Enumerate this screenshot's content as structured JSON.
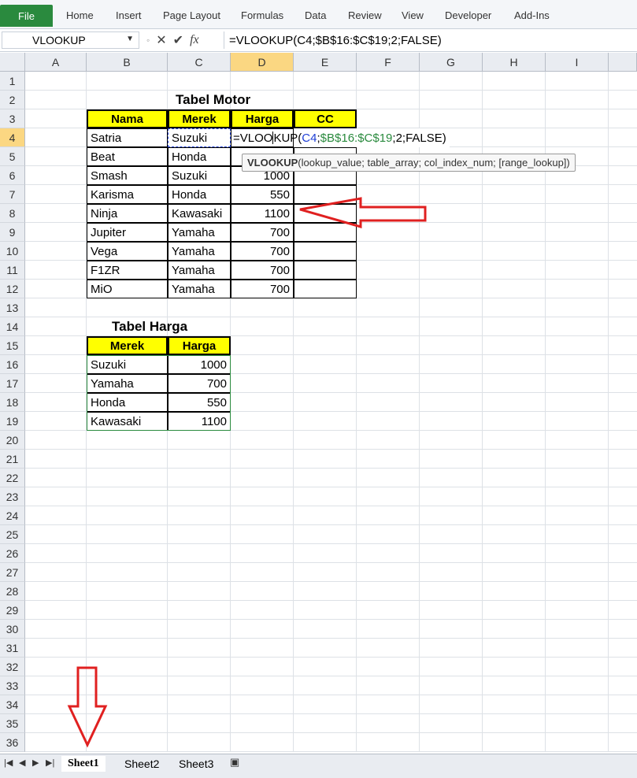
{
  "ribbon": {
    "file": "File",
    "tabs": [
      "Home",
      "Insert",
      "Page Layout",
      "Formulas",
      "Data",
      "Review",
      "View",
      "Developer",
      "Add-Ins"
    ]
  },
  "formula_bar": {
    "name_box": "VLOOKUP",
    "fx": "fx",
    "formula": "=VLOOKUP(C4;$B$16:$C$19;2;FALSE)"
  },
  "columns": [
    "A",
    "B",
    "C",
    "D",
    "E",
    "F",
    "G",
    "H",
    "I"
  ],
  "rows": [
    "1",
    "2",
    "3",
    "4",
    "5",
    "6",
    "7",
    "8",
    "9",
    "10",
    "11",
    "12",
    "13",
    "14",
    "15",
    "16",
    "17",
    "18",
    "19",
    "20",
    "21",
    "22",
    "23",
    "24",
    "25",
    "26",
    "27",
    "28",
    "29",
    "30",
    "31",
    "32",
    "33",
    "34",
    "35",
    "36"
  ],
  "tabel_motor": {
    "title": "Tabel Motor",
    "headers": [
      "Nama",
      "Merek",
      "Harga",
      "CC"
    ],
    "rows": [
      {
        "nama": "Satria",
        "merek": "Suzuki",
        "harga": ""
      },
      {
        "nama": "Beat",
        "merek": "Honda",
        "harga": ""
      },
      {
        "nama": "Smash",
        "merek": "Suzuki",
        "harga": "1000"
      },
      {
        "nama": "Karisma",
        "merek": "Honda",
        "harga": "550"
      },
      {
        "nama": "Ninja",
        "merek": "Kawasaki",
        "harga": "1100"
      },
      {
        "nama": "Jupiter",
        "merek": "Yamaha",
        "harga": "700"
      },
      {
        "nama": "Vega",
        "merek": "Yamaha",
        "harga": "700"
      },
      {
        "nama": "F1ZR",
        "merek": "Yamaha",
        "harga": "700"
      },
      {
        "nama": "MiO",
        "merek": "Yamaha",
        "harga": "700"
      }
    ],
    "edit_cell": {
      "prefix": "=VLOO",
      "cursor_after": "KUP(",
      "ref1": "C4",
      "sep1": ";",
      "ref2": "$B$16:$C$19",
      "rest": ";2;FALSE)"
    },
    "tooltip": {
      "fn": "VLOOKUP",
      "args": "(lookup_value; table_array; col_index_num; [range_lookup])"
    }
  },
  "tabel_harga": {
    "title": "Tabel Harga",
    "headers": [
      "Merek",
      "Harga"
    ],
    "rows": [
      {
        "merek": "Suzuki",
        "harga": "1000"
      },
      {
        "merek": "Yamaha",
        "harga": "700"
      },
      {
        "merek": "Honda",
        "harga": "550"
      },
      {
        "merek": "Kawasaki",
        "harga": "1100"
      }
    ]
  },
  "sheets": [
    "Sheet1",
    "Sheet2",
    "Sheet3"
  ],
  "colors": {
    "header_fill": "#ffff00",
    "ref1_color": "#1f3fd6",
    "ref2_color": "#2a8a3e",
    "arrow_color": "#e02020",
    "file_tab": "#2a8a3e"
  }
}
